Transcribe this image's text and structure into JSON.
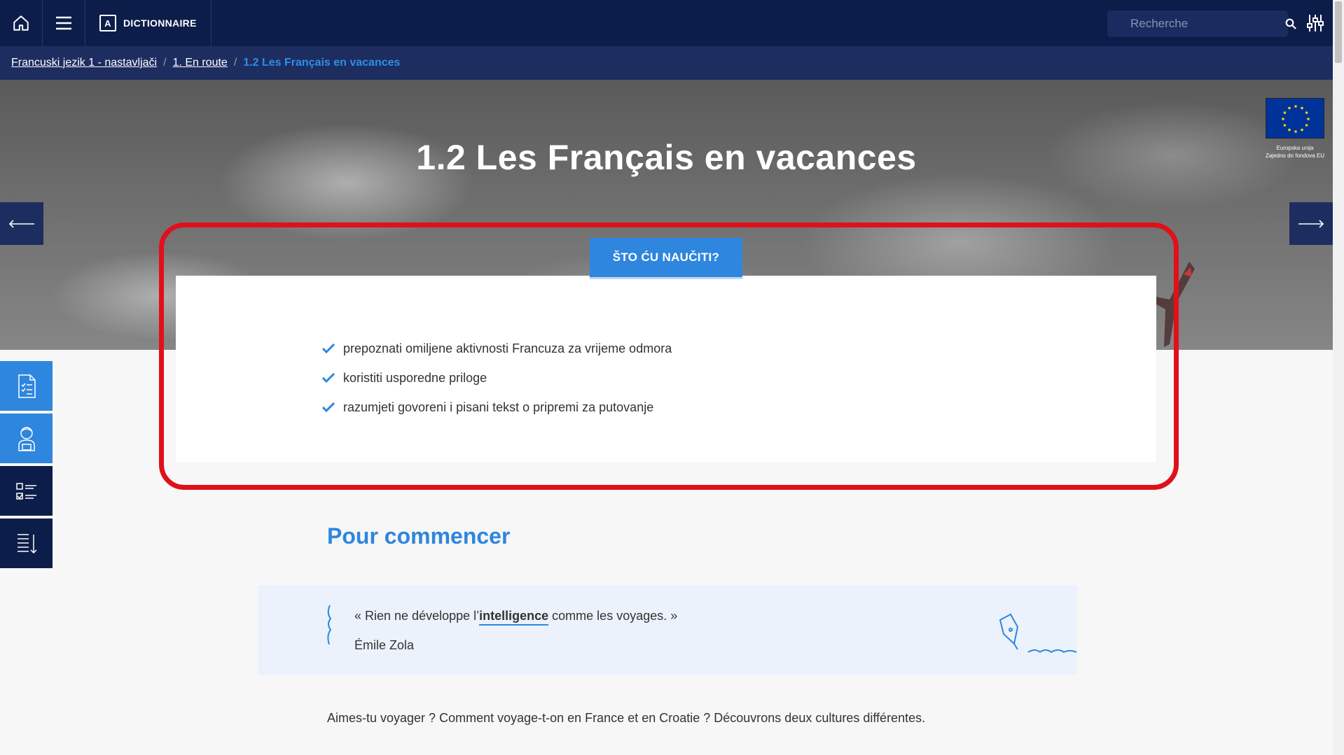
{
  "topbar": {
    "home_icon": "home-icon",
    "menu_icon": "hamburger-menu-icon",
    "dictionary": {
      "letter": "A",
      "label": "DICTIONNAIRE"
    },
    "search": {
      "placeholder": "Recherche",
      "icon": "search-icon"
    },
    "settings_icon": "sliders-icon"
  },
  "breadcrumb": [
    {
      "label": "Francuski jezik 1 - nastavljači"
    },
    {
      "label": "1. En route"
    },
    {
      "label": "1.2 Les Français en vacances"
    }
  ],
  "breadcrumb_separator": "/",
  "hero": {
    "title": "1.2 Les Français en vacances",
    "eu_logo": {
      "line1": "Europska unija",
      "line2": "Zajedno do fondova EU"
    }
  },
  "learning": {
    "button_label": "ŠTO ĆU NAUČITI?",
    "items": [
      "prepoznati omiljene aktivnosti Francuza za vrijeme odmora",
      "koristiti usporedne priloge",
      "razumjeti govoreni i pisani tekst o pripremi za putovanje"
    ]
  },
  "side_tools": [
    "document-checklist-icon",
    "student-icon",
    "checklist-icon",
    "sort-list-icon"
  ],
  "content": {
    "section_title": "Pour commencer",
    "quote": {
      "before": "« Rien ne développe l’",
      "keyword": "intelligence",
      "after": " comme les voyages. »",
      "author": "Émile Zola"
    },
    "intro": "Aimes-tu voyager ? Comment voyage-t-on en France et en Croatie ? Découvrons deux cultures différentes."
  },
  "colors": {
    "navy": "#0d1d4a",
    "breadcrumb_bg": "#1d2d5f",
    "accent_blue": "#2e86de",
    "highlight_red": "#e0101b",
    "quote_bg": "#ebf2fb"
  }
}
